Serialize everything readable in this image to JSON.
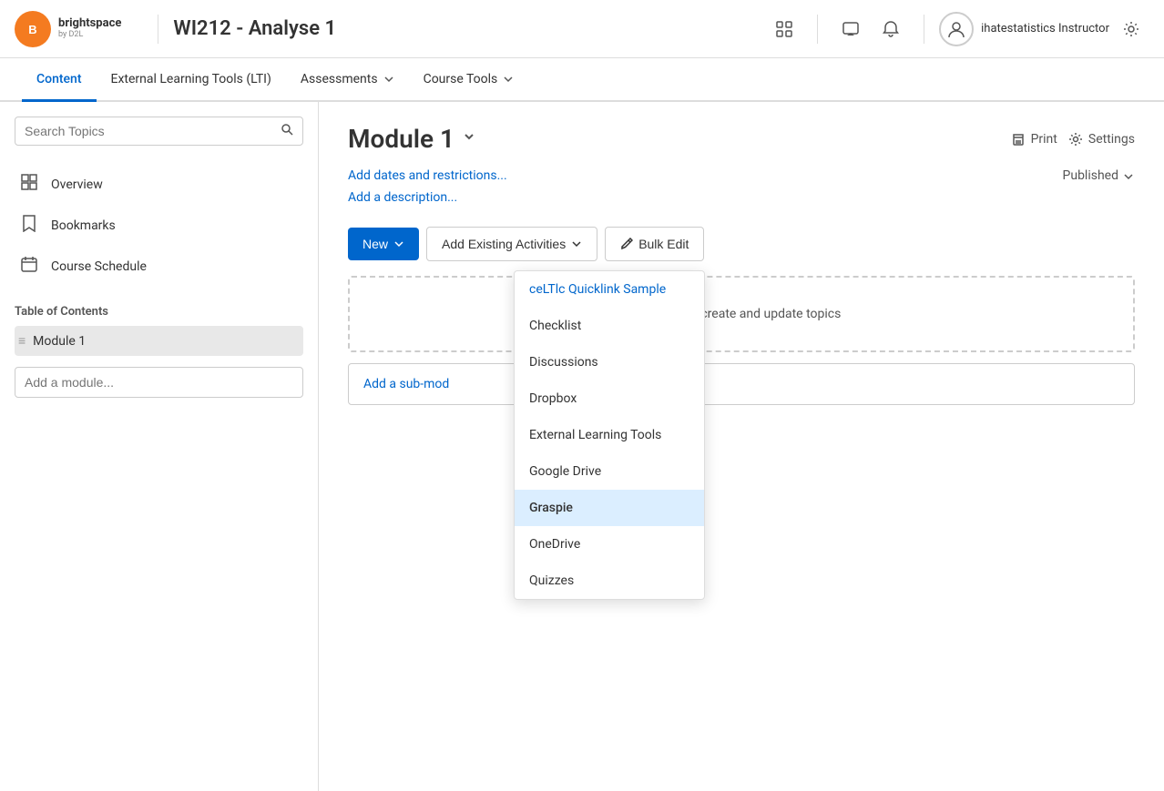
{
  "topBar": {
    "logoInitial": "B",
    "logoSubtext": "brightspace",
    "pageTitle": "WI212 - Analyse 1",
    "userName": "ihatestatistics Instructor"
  },
  "secondaryNav": {
    "items": [
      {
        "label": "Content",
        "active": true,
        "hasDropdown": false
      },
      {
        "label": "External Learning Tools (LTI)",
        "active": false,
        "hasDropdown": false
      },
      {
        "label": "Assessments",
        "active": false,
        "hasDropdown": true
      },
      {
        "label": "Course Tools",
        "active": false,
        "hasDropdown": true
      }
    ]
  },
  "sidebar": {
    "searchPlaceholder": "Search Topics",
    "items": [
      {
        "label": "Overview",
        "icon": "📊"
      },
      {
        "label": "Bookmarks",
        "icon": "🔖"
      },
      {
        "label": "Course Schedule",
        "icon": "📅"
      }
    ],
    "sectionTitle": "Table of Contents",
    "modules": [
      {
        "label": "Module 1"
      }
    ],
    "addModulePlaceholder": "Add a module..."
  },
  "content": {
    "moduleTitle": "Module 1",
    "addDatesLabel": "Add dates and restrictions...",
    "addDescriptionLabel": "Add a description...",
    "publishedLabel": "Published",
    "toolbar": {
      "newLabel": "New",
      "addExistingLabel": "Add Existing Activities",
      "bulkEditLabel": "Bulk Edit"
    },
    "dashedAreaText": "es here to create and update topics",
    "addSubModuleLabel": "Add a sub-mod"
  },
  "headerActions": {
    "printLabel": "Print",
    "settingsLabel": "Settings"
  },
  "dropdown": {
    "items": [
      {
        "label": "ceLTlc Quicklink Sample",
        "active": false,
        "linkStyle": true
      },
      {
        "label": "Checklist",
        "active": false,
        "linkStyle": false
      },
      {
        "label": "Discussions",
        "active": false,
        "linkStyle": false
      },
      {
        "label": "Dropbox",
        "active": false,
        "linkStyle": false
      },
      {
        "label": "External Learning Tools",
        "active": false,
        "linkStyle": false
      },
      {
        "label": "Google Drive",
        "active": false,
        "linkStyle": false
      },
      {
        "label": "Graspie",
        "active": true,
        "linkStyle": false
      },
      {
        "label": "OneDrive",
        "active": false,
        "linkStyle": false
      },
      {
        "label": "Quizzes",
        "active": false,
        "linkStyle": false
      }
    ]
  }
}
